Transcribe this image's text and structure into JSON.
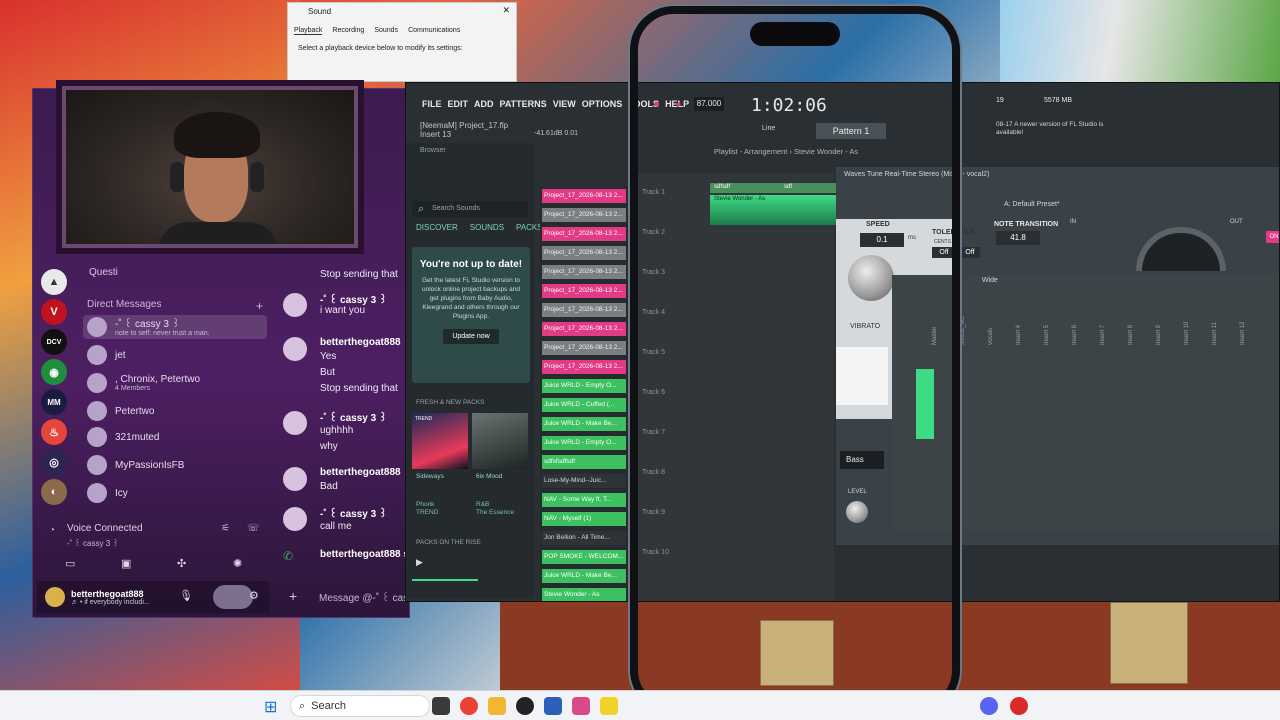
{
  "sound_dialog": {
    "title": "Sound",
    "tabs": [
      "Playback",
      "Recording",
      "Sounds",
      "Communications"
    ],
    "instruction": "Select a playback device below to modify its settings:"
  },
  "discord": {
    "search_hint": "Questi",
    "dm_header": "Direct Messages",
    "dms": [
      {
        "name": "-˚ ꒰ cassy 3 ꒱",
        "sub": "note to self: never trust a man."
      },
      {
        "name": "jet",
        "sub": ""
      },
      {
        "name": ", Chronix, Petertwo",
        "sub": "4 Members"
      },
      {
        "name": "Petertwo",
        "sub": ""
      },
      {
        "name": "321muted",
        "sub": ""
      },
      {
        "name": "MyPassionIsFB",
        "sub": ""
      },
      {
        "name": "Icy",
        "sub": ""
      }
    ],
    "chat_top": "Stop sending that",
    "messages": [
      {
        "name": "-˚ ꒰ cassy 3 ꒱",
        "lines": [
          "i want you"
        ]
      },
      {
        "name": "betterthegoat888",
        "lines": [
          "Yes",
          "But",
          "Stop sending that"
        ]
      },
      {
        "name": "-˚ ꒰ cassy 3 ꒱",
        "lines": [
          "ughhhh",
          "why"
        ]
      },
      {
        "name": "betterthegoat888",
        "lines": [
          "Bad"
        ]
      },
      {
        "name": "-˚ ꒰ cassy 3 ꒱",
        "lines": [
          "call me"
        ]
      },
      {
        "name": "betterthegoat888 st",
        "lines": []
      }
    ],
    "voice_status": "Voice Connected",
    "voice_channel": "-˚ ꒰ cassy 3 ꒱",
    "user_name": "betterthegoat888",
    "user_status": "♬ • if everybody includi...",
    "message_placeholder": "Message @-˚ ꒰ cass",
    "servers": [
      "▲",
      "V",
      "DCV",
      "◉",
      "MM",
      "♨",
      "◎",
      "◐"
    ]
  },
  "fl_studio": {
    "menu": [
      "FILE",
      "EDIT",
      "ADD",
      "PATTERNS",
      "VIEW",
      "OPTIONS",
      "TOOLS",
      "HELP"
    ],
    "project": "[NeemaM] Project_17.flp",
    "insert": "Insert 13",
    "level": "-41.61dB 0.01",
    "tempo": "87.000",
    "time": "1:02:06",
    "cpu": "19",
    "memory": "5578 MB",
    "update_notice": "08-17  A newer version of FL Studio is available!",
    "pattern": "Pattern 1",
    "line_mode": "Line",
    "browser_label": "Browser",
    "search_placeholder": "Search Sounds",
    "browser_tabs": [
      "DISCOVER",
      "SOUNDS",
      "PACKS"
    ],
    "promo_title": "You're not up to date!",
    "promo_text": "Get the latest FL Studio version to unlock online project backups and get plugins from Baby Audio, Kleegrand and others through our Plugins App.",
    "promo_button": "Update now",
    "fresh_packs": "FRESH & NEW PACKS",
    "packs": [
      {
        "cover": "TREND",
        "name": "Sideways",
        "genre": "Phonk",
        "artist": "TREND"
      },
      {
        "cover": "",
        "name": "6ix Mood",
        "genre": "R&B",
        "artist": "The Essence"
      }
    ],
    "packs_rise": "PACKS ON THE RISE",
    "files": [
      {
        "name": "Project_17_2026-08-13 2...",
        "color": "pink"
      },
      {
        "name": "Project_17_2026-08-13 2...",
        "color": "gray"
      },
      {
        "name": "Project_17_2026-08-13 2...",
        "color": "pink"
      },
      {
        "name": "Project_17_2026-08-13 2...",
        "color": "gray"
      },
      {
        "name": "Project_17_2026-08-13 2...",
        "color": "gray"
      },
      {
        "name": "Project_17_2026-08-13 2...",
        "color": "pink"
      },
      {
        "name": "Project_17_2026-08-13 2...",
        "color": "gray"
      },
      {
        "name": "Project_17_2026-08-13 2...",
        "color": "pink"
      },
      {
        "name": "Project_17_2026-08-13 2...",
        "color": "gray"
      },
      {
        "name": "Project_17_2026-08-13 2...",
        "color": "pink"
      },
      {
        "name": "Juice WRLD - Empty O...",
        "color": "green"
      },
      {
        "name": "Juice WRLD - Cuffed (...",
        "color": "green"
      },
      {
        "name": "Juice WRLD - Make Be...",
        "color": "green"
      },
      {
        "name": "Juice WRLD - Empty O...",
        "color": "green"
      },
      {
        "name": "sdfsfsdfsdf",
        "color": "green"
      },
      {
        "name": "Lose-My-Mind--Juic...",
        "color": "dark"
      },
      {
        "name": "NAV - Some Way ft. T...",
        "color": "green"
      },
      {
        "name": "NAV - Myself (1)",
        "color": "green"
      },
      {
        "name": "Jon Bellion - All Time...",
        "color": "dark"
      },
      {
        "name": "POP SMOKE - WELCOM...",
        "color": "green"
      },
      {
        "name": "Juice WRLD - Make Be...",
        "color": "green"
      },
      {
        "name": "Stevie Wonder - As",
        "color": "green"
      }
    ],
    "playlist_title": "Playlist - Arrangement › Stevie Wonder - As",
    "tracks": [
      "Track 1",
      "Track 2",
      "Track 3",
      "Track 4",
      "Track 5",
      "Track 6",
      "Track 7",
      "Track 8",
      "Track 9",
      "Track 10"
    ],
    "clips": [
      "sdfsdf",
      "sdf"
    ],
    "clip_main": "Stevie Wonder - As",
    "vst": {
      "title": "Waves Tune Real-Time Stereo (Mixer - vocal2)",
      "preset": "A: Default Preset*",
      "speed_label": "SPEED",
      "speed_value": "0.1",
      "speed_unit": "ms",
      "tolerance_label": "TOLERANCE",
      "cents_label": "CENTS",
      "off_label": "Off",
      "note_transition_label": "NOTE TRANSITION",
      "note_transition_value": "41.8",
      "vibrato_label": "VIBRATO",
      "bass_label": "Bass",
      "level_label": "LEVEL",
      "in_label": "IN",
      "out_label": "OUT",
      "on_label": "ON"
    },
    "mixer_wide": "Wide",
    "mixer_tracks": [
      "Master",
      "JUICE_8G",
      "vocals",
      "Insert 4",
      "Insert 5",
      "Insert 6",
      "Insert 7",
      "Insert 8",
      "Insert 9",
      "Insert 10",
      "Insert 11",
      "Insert 12"
    ]
  },
  "taskbar": {
    "search_label": "Search"
  },
  "colors": {
    "fl_accent": "#3ddc84",
    "discord_bg": "#3b1c50",
    "pink_clip": "#e33a85",
    "green_clip": "#3cc060"
  }
}
